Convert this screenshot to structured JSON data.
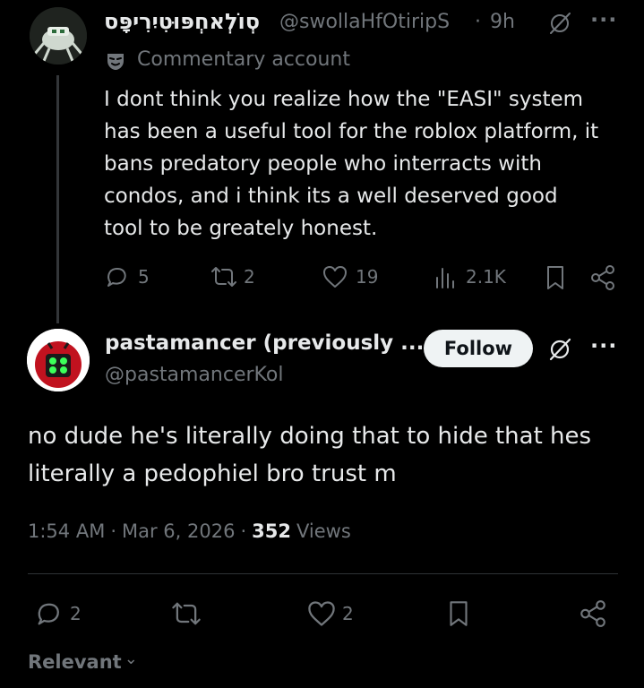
{
  "parent_post": {
    "display_name": "סְוֹלְאחְפּוּטִיִרִיפָּס",
    "handle": "@swollaHfOtiripS",
    "time_sep": "·",
    "time": "9h",
    "label_icon": "theater-mask-icon",
    "label_text": "Commentary account",
    "text_lines": [
      "I dont think you realize how the \"EASI\" system",
      "has been a useful tool for the roblox platform, it",
      "bans predatory people who interracts with",
      "condos, and i think its a well deserved good",
      "tool to be greately honest."
    ],
    "actions": {
      "replies": "5",
      "reposts": "2",
      "likes": "19",
      "views": "2.1K"
    }
  },
  "main_post": {
    "display_name": "pastamancer (previously ...",
    "handle": "@pastamancerKol",
    "follow_label": "Follow",
    "more": "···",
    "text_lines": [
      "no dude he's literally doing that to hide that hes",
      "literally a pedophiel bro trust m"
    ],
    "meta": {
      "time": "1:54 AM",
      "sep1": "·",
      "date": "Mar 6, 2026",
      "sep2": "·",
      "views_count": "352",
      "views_label": "Views"
    },
    "actions": {
      "replies": "2",
      "likes": "2"
    }
  },
  "parent_more": "···",
  "sort": {
    "label": "Relevant",
    "chevron": "⌄"
  },
  "colors": {
    "background": "#000000",
    "text": "#e7e9ea",
    "muted": "#71767b",
    "divider": "#2f3336",
    "follow_bg": "#eff3f4"
  }
}
